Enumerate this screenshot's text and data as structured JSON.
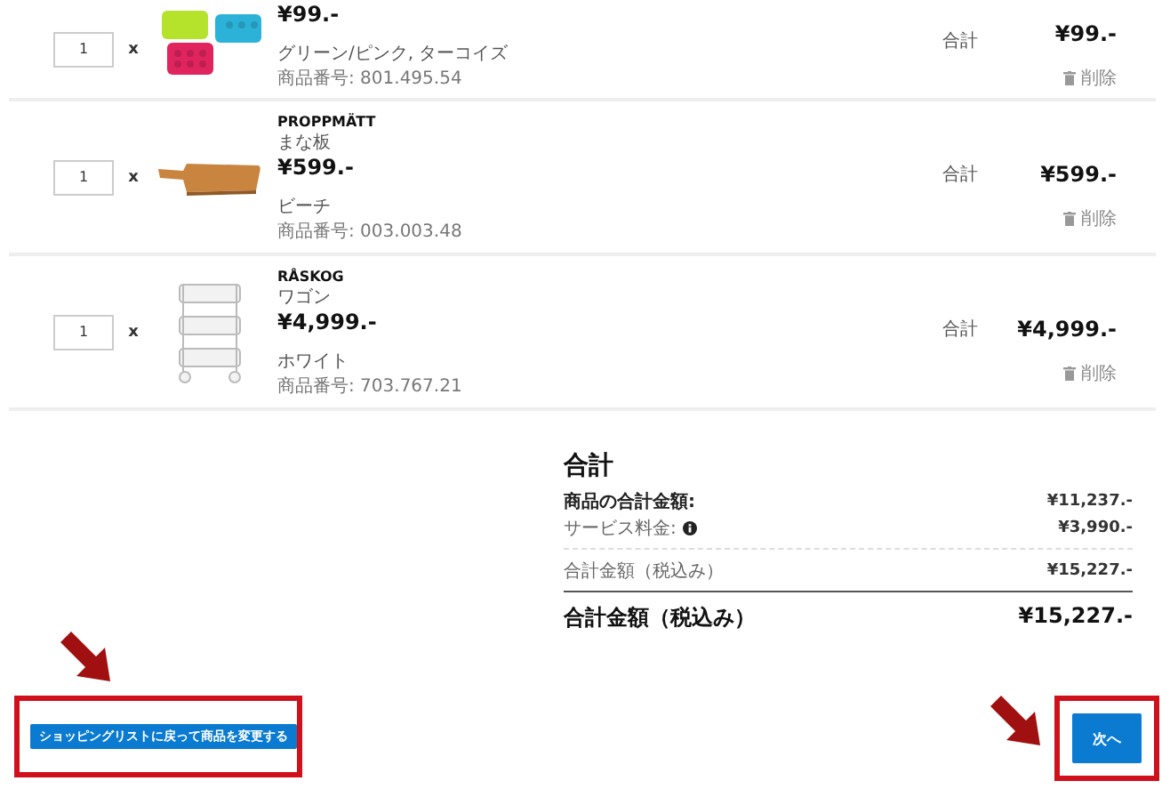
{
  "cart_items": [
    {
      "quantity": "1",
      "multiply": "x",
      "kind": "ice-trays",
      "price": "¥99.-",
      "variant": "グリーン/ピンク, ターコイズ",
      "article_number": "商品番号: 801.495.54",
      "total_label": "合計",
      "total": "¥99.-",
      "delete": "削除"
    },
    {
      "quantity": "1",
      "multiply": "x",
      "kind": "cutting-board",
      "name": "PROPPMÄTT",
      "type": "まな板",
      "price": "¥599.-",
      "variant": "ビーチ",
      "article_number": "商品番号: 003.003.48",
      "total_label": "合計",
      "total": "¥599.-",
      "delete": "削除"
    },
    {
      "quantity": "1",
      "multiply": "x",
      "kind": "cart",
      "name": "RÅSKOG",
      "type": "ワゴン",
      "price": "¥4,999.-",
      "variant": "ホワイト",
      "article_number": "商品番号: 703.767.21",
      "total_label": "合計",
      "total": "¥4,999.-",
      "delete": "削除"
    }
  ],
  "summary": {
    "title": "合計",
    "lines": [
      {
        "kind": "bold",
        "label": "商品の合計金額:",
        "value": "¥11,237.-"
      },
      {
        "kind": "info",
        "label": "サービス料金:",
        "value": "¥3,990.-"
      },
      {
        "kind": "subtotal",
        "label": "合計金額（税込み）",
        "value": "¥15,227.-"
      }
    ],
    "grand_total": {
      "label": "合計金額（税込み）",
      "value": "¥15,227.-"
    }
  },
  "back_button": "ショッピングリストに戻って商品を変更する",
  "next_button": "次へ"
}
